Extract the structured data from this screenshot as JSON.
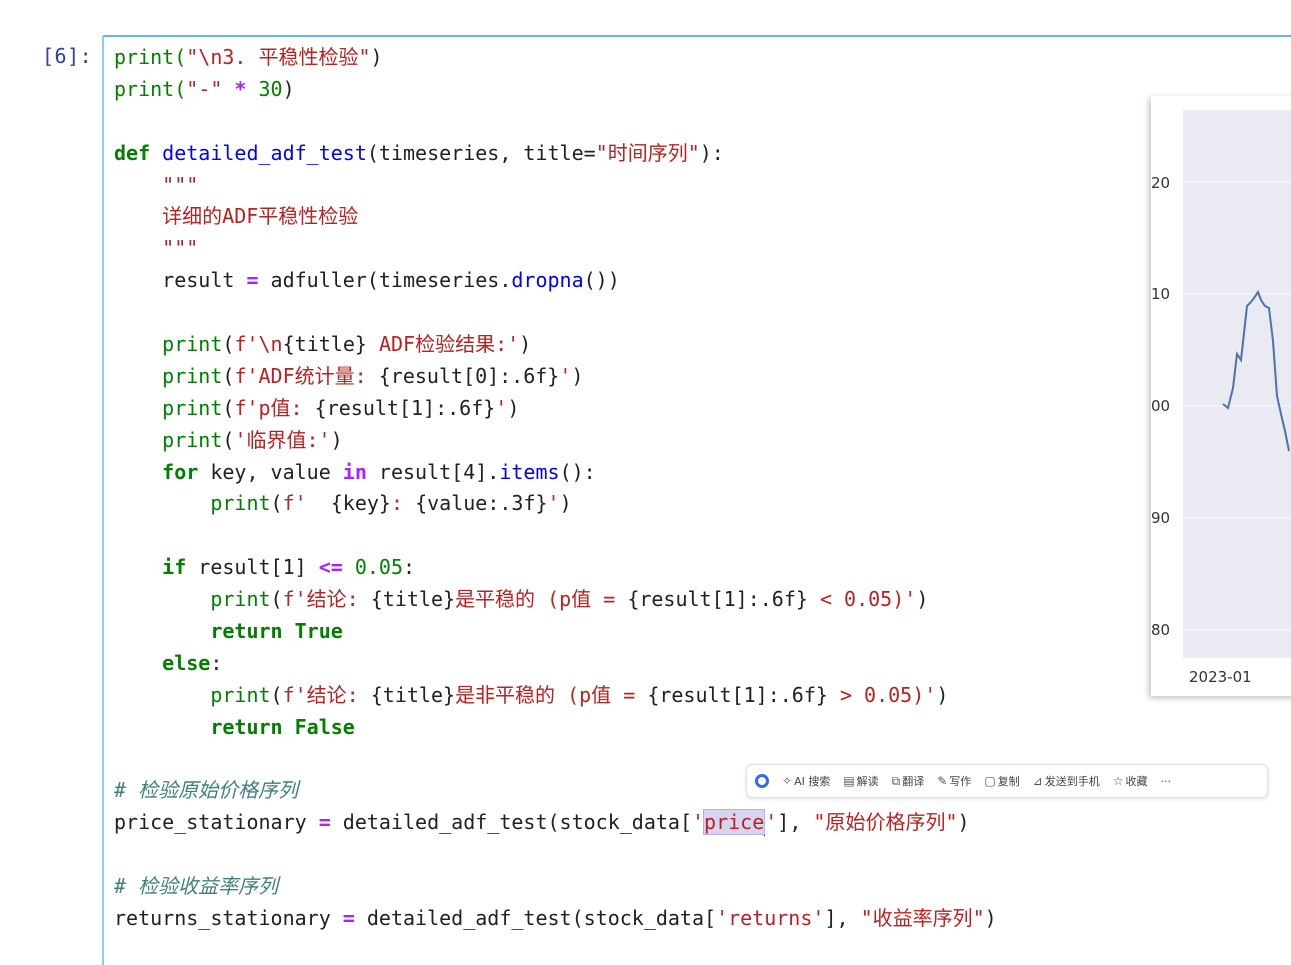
{
  "cell": {
    "prompt": "[6]:"
  },
  "code": {
    "l1": {
      "a": "print(",
      "b": "\"\\n3. 平稳性检验\"",
      "c": ")"
    },
    "l2": {
      "a": "print(",
      "b": "\"-\"",
      "c": " * ",
      "d": "30",
      "e": ")"
    },
    "l3": {
      "kw": "def",
      "name": "detailed_adf_test",
      "a": "(timeseries, title=",
      "b": "\"时间序列\"",
      "c": "):"
    },
    "doc_open": "\"\"\"",
    "doc_text": "详细的ADF平稳性检验",
    "doc_close": "\"\"\"",
    "l_result": {
      "a": "result ",
      "eq": "=",
      "b": " adfuller(timeseries.",
      "m": "dropna",
      "c": "())"
    },
    "p1": {
      "f": "print",
      "a": "(",
      "s1": "f'\\n",
      "i": "{title}",
      "s2": " ADF检验结果:'",
      "c": ")"
    },
    "p2": {
      "f": "print",
      "a": "(",
      "s1": "f'ADF统计量: ",
      "i": "{result[0]:.6f}",
      "s2": "'",
      "c": ")"
    },
    "p3": {
      "f": "print",
      "a": "(",
      "s1": "f'p值: ",
      "i": "{result[1]:.6f}",
      "s2": "'",
      "c": ")"
    },
    "p4": {
      "f": "print",
      "a": "(",
      "s1": "'临界值:'",
      "c": ")"
    },
    "for": {
      "kw": "for",
      "a": " key, value ",
      "in": "in",
      "b": " result[4].",
      "m": "items",
      "c": "():"
    },
    "p5": {
      "f": "print",
      "a": "(",
      "s1": "f'  ",
      "i1": "{key}",
      "s2": ": ",
      "i2": "{value:.3f}",
      "s3": "'",
      "c": ")"
    },
    "if": {
      "kw": "if",
      "a": " result[1] ",
      "op": "<=",
      "n": " 0.05",
      "c": ":"
    },
    "p6": {
      "f": "print",
      "a": "(",
      "s1": "f'结论: ",
      "i1": "{title}",
      "s2": "是平稳的 (p值 = ",
      "i2": "{result[1]:.6f}",
      "s3": " < 0.05)'",
      "c": ")"
    },
    "ret_true": {
      "kw": "return",
      "v": " True"
    },
    "else": {
      "kw": "else",
      "c": ":"
    },
    "p7": {
      "f": "print",
      "a": "(",
      "s1": "f'结论: ",
      "i1": "{title}",
      "s2": "是非平稳的 (p值 = ",
      "i2": "{result[1]:.6f}",
      "s3": " > 0.05)'",
      "c": ")"
    },
    "ret_false": {
      "kw": "return",
      "v": " False"
    },
    "cm1": "# 检验原始价格序列",
    "price": {
      "a": "price_stationary ",
      "eq": "=",
      "b": " detailed_adf_test(stock_data[",
      "q1": "'",
      "sel": "price",
      "q2": "'",
      "c": "], ",
      "s": "\"原始价格序列\"",
      "d": ")"
    },
    "cm2": "# 检验收益率序列",
    "returns": {
      "a": "returns_stationary ",
      "eq": "=",
      "b": " detailed_adf_test(stock_data[",
      "s1": "'returns'",
      "c": "], ",
      "s": "\"收益率序列\"",
      "d": ")"
    }
  },
  "chart_data": {
    "type": "line",
    "yticks": [
      "20",
      "10",
      "00",
      "90",
      "80"
    ],
    "xticks": [
      "2023-01"
    ],
    "series_color": "#4c72b0",
    "grid": true
  },
  "toolbar": {
    "items": [
      {
        "icon": "ai-search-icon",
        "glyph": "✧",
        "label": "AI 搜索"
      },
      {
        "icon": "explain-icon",
        "glyph": "▤",
        "label": "解读"
      },
      {
        "icon": "translate-icon",
        "glyph": "⧉",
        "label": "翻译"
      },
      {
        "icon": "write-icon",
        "glyph": "✎",
        "label": "写作"
      },
      {
        "icon": "copy-icon",
        "glyph": "▢",
        "label": "复制"
      },
      {
        "icon": "send-to-phone-icon",
        "glyph": "⊿",
        "label": "发送到手机"
      },
      {
        "icon": "star-icon",
        "glyph": "☆",
        "label": "收藏"
      }
    ],
    "more": "···"
  }
}
